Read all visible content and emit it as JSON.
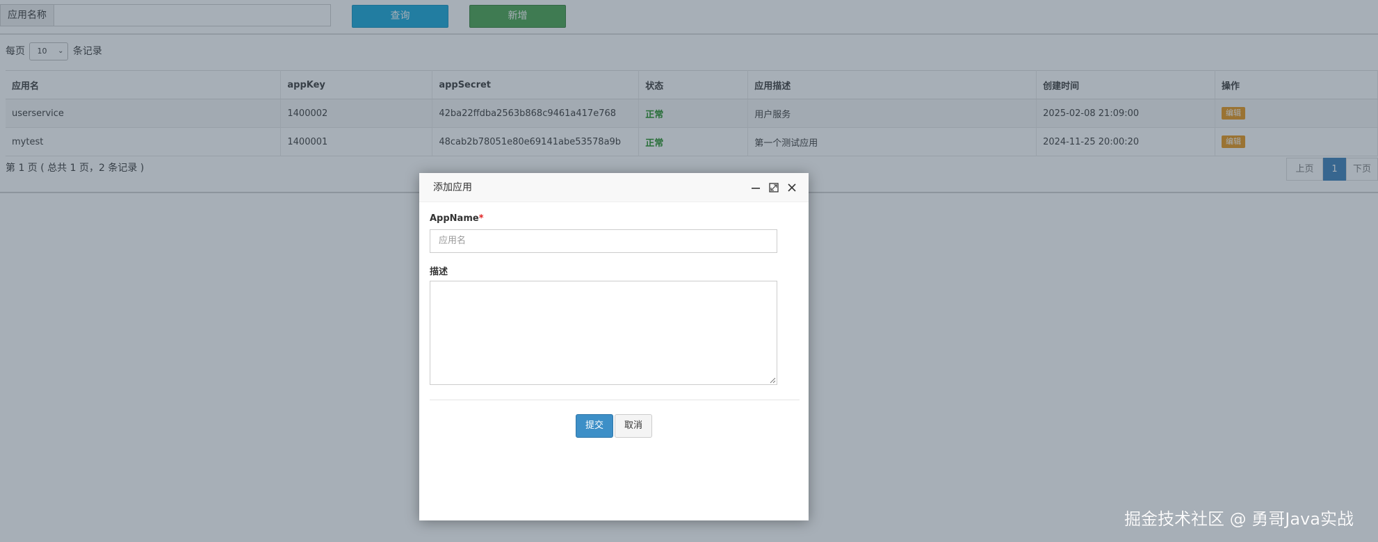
{
  "search": {
    "label": "应用名称",
    "value": "",
    "query_label": "查询",
    "add_label": "新增"
  },
  "page_size": {
    "prefix": "每页",
    "value": "10",
    "suffix": "条记录"
  },
  "table": {
    "columns": [
      "应用名",
      "appKey",
      "appSecret",
      "状态",
      "应用描述",
      "创建时间",
      "操作"
    ],
    "rows": [
      {
        "name": "userservice",
        "app_key": "1400002",
        "app_secret": "42ba22ffdba2563b868c9461a417e768",
        "status": "正常",
        "desc": "用户服务",
        "created": "2025-02-08 21:09:00",
        "action": "编辑"
      },
      {
        "name": "mytest",
        "app_key": "1400001",
        "app_secret": "48cab2b78051e80e69141abe53578a9b",
        "status": "正常",
        "desc": "第一个测试应用",
        "created": "2024-11-25 20:00:20",
        "action": "编辑"
      }
    ]
  },
  "pagination": {
    "info": "第 1 页 ( 总共 1 页，2 条记录 )",
    "prev": "上页",
    "current": "1",
    "next": "下页"
  },
  "modal": {
    "title": "添加应用",
    "app_name_label": "AppName",
    "required_mark": "*",
    "app_name_placeholder": "应用名",
    "desc_label": "描述",
    "submit": "提交",
    "cancel": "取消"
  },
  "watermark": "掘金技术社区 @ 勇哥Java实战",
  "colors": {
    "query_button": "#0ea5d8",
    "add_button": "#43a047",
    "status_ok": "#1a8a1a",
    "edit_button": "#e8920f",
    "pager_active": "#337ab7",
    "submit_button": "#3d8fc7"
  }
}
